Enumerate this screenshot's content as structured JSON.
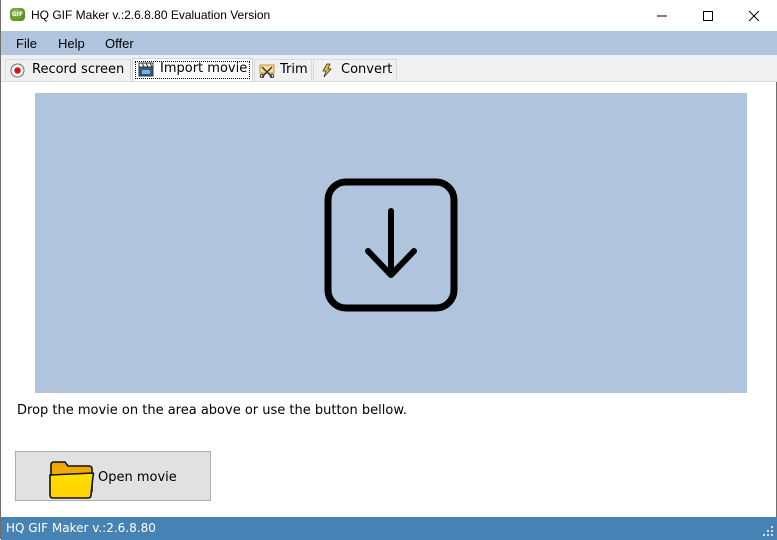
{
  "window": {
    "title": "HQ GIF Maker v.:2.6.8.80 Evaluation Version",
    "app_icon_text": "GIF"
  },
  "menu": {
    "items": [
      {
        "label": "File"
      },
      {
        "label": "Help"
      },
      {
        "label": "Offer"
      }
    ]
  },
  "tabs": [
    {
      "label": "Record screen",
      "icon": "record-icon",
      "active": false
    },
    {
      "label": "Import movie",
      "icon": "clapperboard-icon",
      "active": true
    },
    {
      "label": "Trim",
      "icon": "trim-icon",
      "active": false
    },
    {
      "label": "Convert",
      "icon": "lightning-icon",
      "active": false
    }
  ],
  "main": {
    "drop_area_icon": "download-arrow-icon",
    "hint": "Drop the movie on the area above or use the button bellow.",
    "open_button_label": "Open movie",
    "open_button_icon": "folder-icon"
  },
  "status": {
    "text": "HQ GIF Maker v.:2.6.8.80"
  },
  "colors": {
    "menubar": "#b0c4de",
    "drop_area": "#b0c4de",
    "statusbar": "#4682b4"
  }
}
